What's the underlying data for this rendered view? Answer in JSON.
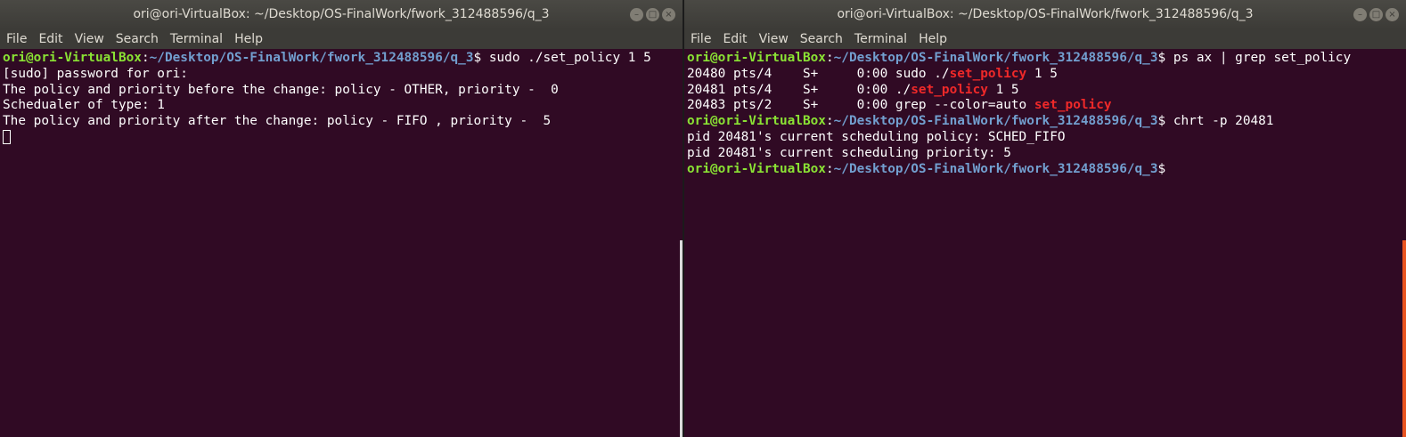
{
  "left_window": {
    "title": "ori@ori-VirtualBox: ~/Desktop/OS-FinalWork/fwork_312488596/q_3",
    "menu": [
      "File",
      "Edit",
      "View",
      "Search",
      "Terminal",
      "Help"
    ],
    "prompt_user": "ori@ori-VirtualBox",
    "prompt_path": "~/Desktop/OS-FinalWork/fwork_312488596/q_3",
    "command": "sudo ./set_policy 1 5",
    "lines": [
      "[sudo] password for ori:",
      "The policy and priority before the change: policy - OTHER, priority -  0",
      "Schedualer of type: 1",
      "The policy and priority after the change: policy - FIFO , priority -  5"
    ]
  },
  "right_window": {
    "title": "ori@ori-VirtualBox: ~/Desktop/OS-FinalWork/fwork_312488596/q_3",
    "menu": [
      "File",
      "Edit",
      "View",
      "Search",
      "Terminal",
      "Help"
    ],
    "prompt_user": "ori@ori-VirtualBox",
    "prompt_path": "~/Desktop/OS-FinalWork/fwork_312488596/q_3",
    "command1": "ps ax | grep set_policy",
    "ps_rows": [
      {
        "prefix": "20480 pts/4    S+     0:00 sudo ./",
        "match": "set_policy",
        "suffix": " 1 5"
      },
      {
        "prefix": "20481 pts/4    S+     0:00 ./",
        "match": "set_policy",
        "suffix": " 1 5"
      },
      {
        "prefix": "20483 pts/2    S+     0:00 grep --color=auto ",
        "match": "set_policy",
        "suffix": ""
      }
    ],
    "command2": "chrt -p 20481",
    "chrt_lines": [
      "pid 20481's current scheduling policy: SCHED_FIFO",
      "pid 20481's current scheduling priority: 5"
    ]
  },
  "colors": {
    "terminal_bg": "#300a24",
    "prompt_user": "#8ae234",
    "prompt_path": "#729fcf",
    "grep_match": "#ef2929"
  }
}
